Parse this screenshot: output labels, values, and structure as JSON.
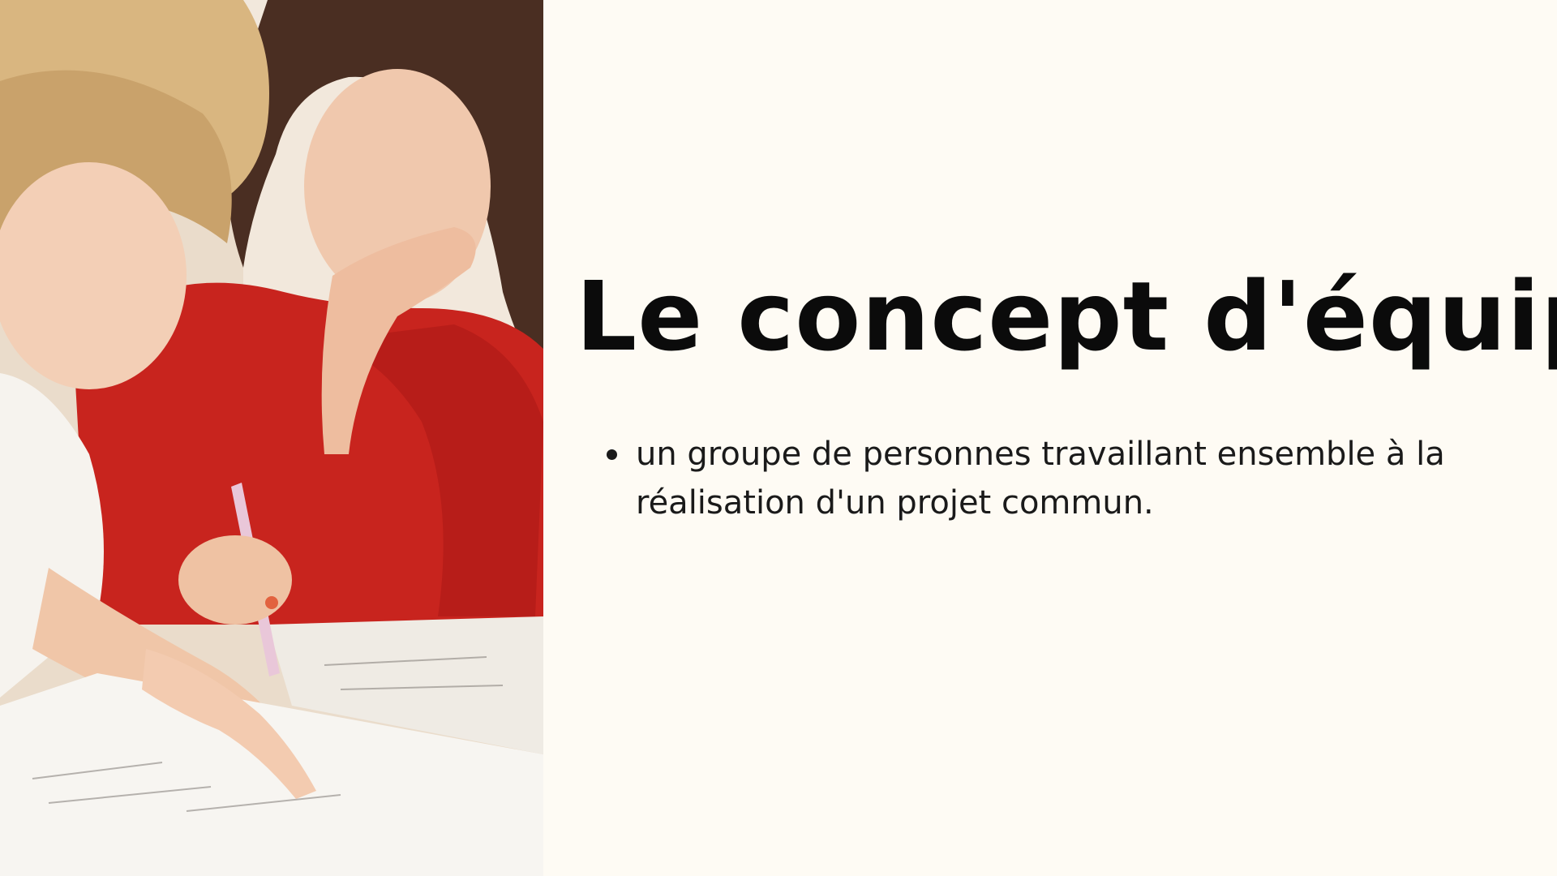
{
  "slide": {
    "title": "Le concept d'équipe",
    "bullets": [
      {
        "text": "un groupe de personnes travaillant ensemble à la réalisation d'un projet commun."
      }
    ]
  },
  "photo": {
    "subject": "two-women-studying-icon"
  },
  "colors": {
    "background": "#fefbf4",
    "title": "#0b0b0b",
    "body_text": "#1a1a1a"
  }
}
